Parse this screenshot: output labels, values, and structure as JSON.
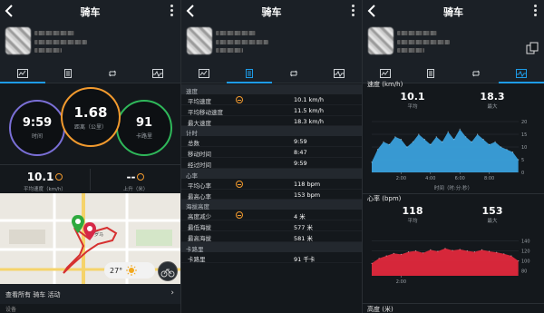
{
  "screens": [
    {
      "title": "骑车"
    },
    {
      "title": "骑车"
    },
    {
      "title": "骑车"
    }
  ],
  "summary": {
    "time": {
      "value": "9:59",
      "label": "时间"
    },
    "distance": {
      "value": "1.68",
      "label": "距离（公里）"
    },
    "calories": {
      "value": "91",
      "label": "卡路里"
    },
    "avg_speed": {
      "value": "10.1",
      "label": "平均速度（km/h）"
    },
    "ascent": {
      "value": "--",
      "label": "上升（米）"
    },
    "weather": "27°",
    "view_all": "查看所有 骑车 活动",
    "settings_peek": "设备"
  },
  "details": {
    "sections": [
      {
        "title": "速度",
        "rows": [
          {
            "k": "平均速度",
            "v": "10.1 km/h",
            "icon": true
          },
          {
            "k": "平均移动速度",
            "v": "11.5 km/h",
            "icon": false
          },
          {
            "k": "最大速度",
            "v": "18.3 km/h",
            "icon": false
          }
        ]
      },
      {
        "title": "计时",
        "rows": [
          {
            "k": "总数",
            "v": "9:59",
            "icon": false
          },
          {
            "k": "移动时间",
            "v": "8:47",
            "icon": false
          },
          {
            "k": "经过时间",
            "v": "9:59",
            "icon": false
          }
        ]
      },
      {
        "title": "心率",
        "rows": [
          {
            "k": "平均心率",
            "v": "118 bpm",
            "icon": true
          },
          {
            "k": "最高心率",
            "v": "153 bpm",
            "icon": false
          }
        ]
      },
      {
        "title": "海拔高度",
        "rows": [
          {
            "k": "高度减少",
            "v": "4 米",
            "icon": true
          },
          {
            "k": "最低海拔",
            "v": "577 米",
            "icon": false
          },
          {
            "k": "最高海拔",
            "v": "581 米",
            "icon": false
          }
        ]
      },
      {
        "title": "卡路里",
        "rows": [
          {
            "k": "卡路里",
            "v": "91 千卡",
            "icon": false
          }
        ]
      }
    ]
  },
  "charts": {
    "speed": {
      "header": "速度 (km/h)",
      "avg": {
        "value": "10.1",
        "label": "平均"
      },
      "max": {
        "value": "18.3",
        "label": "最大"
      },
      "y_ticks": [
        "20",
        "15",
        "10",
        "5",
        "0"
      ],
      "x_ticks": [
        "2:00",
        "4:00",
        "6:00",
        "8:00"
      ],
      "x_label": "时间（时:分:秒）",
      "color": "#3aa0dc"
    },
    "hr": {
      "header": "心率 (bpm)",
      "avg": {
        "value": "118",
        "label": "平均"
      },
      "max": {
        "value": "153",
        "label": "最大"
      },
      "y_ticks": [
        "140",
        "120",
        "100",
        "80"
      ],
      "x_ticks": [
        "2:00"
      ],
      "color": "#e0283c"
    },
    "elevation_header": "高度 (米)"
  },
  "chart_data": [
    {
      "type": "area",
      "title": "速度 (km/h)",
      "xlabel": "时间（时:分:秒）",
      "ylabel": "",
      "ylim": [
        0,
        20
      ],
      "x_ticks": [
        "2:00",
        "4:00",
        "6:00",
        "8:00"
      ],
      "x": [
        0.0,
        0.4,
        0.8,
        1.2,
        1.6,
        2.0,
        2.4,
        2.8,
        3.2,
        3.6,
        4.0,
        4.4,
        4.8,
        5.2,
        5.6,
        6.0,
        6.4,
        6.8,
        7.2,
        7.6,
        8.0,
        8.4,
        8.8,
        9.2,
        9.6,
        9.98
      ],
      "series": [
        {
          "name": "速度",
          "values": [
            4,
            9,
            12,
            11,
            14,
            13,
            10,
            12,
            15,
            13,
            11,
            14,
            12,
            16,
            13,
            17,
            14,
            12,
            15,
            13,
            11,
            12,
            10,
            9,
            8,
            5
          ]
        }
      ]
    },
    {
      "type": "area",
      "title": "心率 (bpm)",
      "ylim": [
        70,
        150
      ],
      "x_ticks": [
        "2:00"
      ],
      "x": [
        0.0,
        0.5,
        1.0,
        1.5,
        2.0,
        2.5,
        3.0,
        3.5,
        4.0,
        4.5,
        5.0,
        5.5,
        6.0,
        6.5,
        7.0,
        7.5,
        8.0,
        8.5,
        9.0,
        9.5,
        9.98
      ],
      "series": [
        {
          "name": "心率",
          "values": [
            95,
            105,
            110,
            115,
            113,
            118,
            120,
            116,
            122,
            119,
            125,
            121,
            123,
            120,
            118,
            122,
            119,
            117,
            114,
            110,
            100
          ]
        }
      ]
    }
  ]
}
